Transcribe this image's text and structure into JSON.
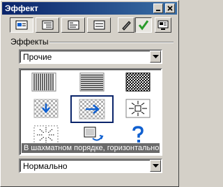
{
  "window": {
    "title": "Эффект"
  },
  "toolbar": {
    "buttons": [
      {
        "icon": "slide-layout-icon",
        "pressed": true
      },
      {
        "icon": "slide-sorter-icon",
        "pressed": false
      },
      {
        "icon": "slide-text-icon",
        "pressed": false
      },
      {
        "icon": "slide-layout-alt-icon",
        "pressed": false
      },
      {
        "icon": "pen-tool-icon",
        "pressed": false
      },
      {
        "icon": "checkmark-icon",
        "pressed": true
      },
      {
        "icon": "preview-screen-icon",
        "pressed": false
      }
    ]
  },
  "effects": {
    "section_label": "Эффекты",
    "category_value": "Прочие",
    "items": [
      {
        "icon": "vertical-blinds-icon"
      },
      {
        "icon": "horizontal-blinds-icon"
      },
      {
        "icon": "dissolve-icon"
      },
      {
        "icon": "checkerboard-down-icon"
      },
      {
        "icon": "checkerboard-across-icon"
      },
      {
        "icon": "box-out-icon"
      },
      {
        "icon": "box-in-icon"
      },
      {
        "icon": "cover-icon"
      },
      {
        "icon": "random-icon"
      }
    ],
    "selected_index": 4,
    "selected_description": "В шахматном порядке, горизонтально",
    "speed_value": "Нормально"
  },
  "colors": {
    "titlebar_start": "#0a246a",
    "titlebar_end": "#3a6ea5",
    "face": "#d4d0c8",
    "accent_green": "#2a9a2a",
    "accent_blue": "#1060d0"
  }
}
